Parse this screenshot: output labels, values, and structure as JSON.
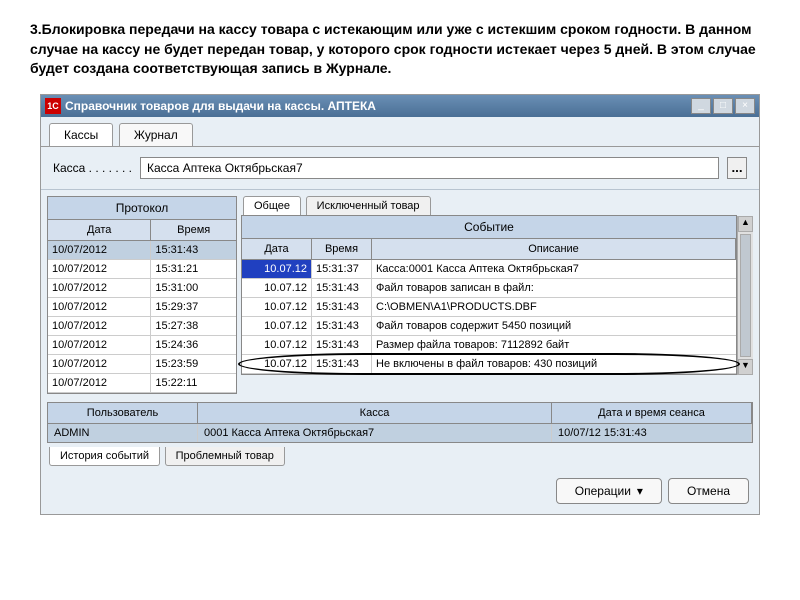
{
  "page_instruction": "3.Блокировка передачи на кассу товара с истекающим или уже с истекшим сроком годности. В данном случае на кассу не будет передан товар, у которого срок годности истекает через 5 дней. В этом случае будет создана соответствующая запись в Журнале.",
  "window": {
    "title": "Справочник товаров для выдачи на кассы. АПТЕКА",
    "icon": "1С"
  },
  "top_tabs": {
    "t0": "Кассы",
    "t1": "Журнал"
  },
  "kassa": {
    "label": "Касса . . . . . . .",
    "value": "Касса Аптека Октябрьская7"
  },
  "protocol": {
    "header": "Протокол",
    "col_date": "Дата",
    "col_time": "Время",
    "rows": [
      {
        "d": "10/07/2012",
        "t": "15:31:43"
      },
      {
        "d": "10/07/2012",
        "t": "15:31:21"
      },
      {
        "d": "10/07/2012",
        "t": "15:31:00"
      },
      {
        "d": "10/07/2012",
        "t": "15:29:37"
      },
      {
        "d": "10/07/2012",
        "t": "15:27:38"
      },
      {
        "d": "10/07/2012",
        "t": "15:24:36"
      },
      {
        "d": "10/07/2012",
        "t": "15:23:59"
      },
      {
        "d": "10/07/2012",
        "t": "15:22:11"
      }
    ]
  },
  "sub_tabs": {
    "s0": "Общее",
    "s1": "Исключенный товар"
  },
  "event": {
    "header": "Событие",
    "col_date": "Дата",
    "col_time": "Время",
    "col_desc": "Описание",
    "rows": [
      {
        "d": "10.07.12",
        "t": "15:31:37",
        "desc": "Касса:0001 Касса Аптека Октябрьская7"
      },
      {
        "d": "10.07.12",
        "t": "15:31:43",
        "desc": "Файл товаров записан в файл:"
      },
      {
        "d": "10.07.12",
        "t": "15:31:43",
        "desc": "C:\\OBMEN\\A1\\PRODUCTS.DBF"
      },
      {
        "d": "10.07.12",
        "t": "15:31:43",
        "desc": "Файл товаров содержит 5450 позиций"
      },
      {
        "d": "10.07.12",
        "t": "15:31:43",
        "desc": "Размер файла товаров: 7112892 байт"
      },
      {
        "d": "10.07.12",
        "t": "15:31:43",
        "desc": "Не включены в файл товаров: 430 позиций"
      }
    ]
  },
  "session": {
    "col_user": "Пользователь",
    "col_kassa": "Касса",
    "col_datetime": "Дата и время сеанса",
    "user": "ADMIN",
    "kassa": "0001 Касса Аптека Октябрьская7",
    "datetime": "10/07/12 15:31:43"
  },
  "bottom_tabs": {
    "b0": "История событий",
    "b1": "Проблемный товар"
  },
  "actions": {
    "ops": "Операции",
    "cancel": "Отмена"
  }
}
